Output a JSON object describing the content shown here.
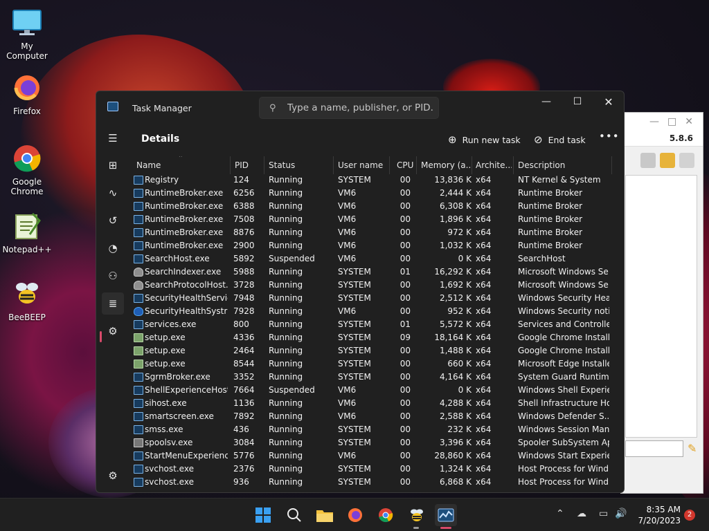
{
  "desktop": {
    "icons": [
      {
        "label": "My Computer"
      },
      {
        "label": "Firefox"
      },
      {
        "label": "Google Chrome"
      },
      {
        "label": "Notepad++"
      },
      {
        "label": "BeeBEEP"
      }
    ]
  },
  "background_window": {
    "version": "5.8.6"
  },
  "task_manager": {
    "title": "Task Manager",
    "search_placeholder": "Type a name, publisher, or PID...",
    "page_title": "Details",
    "run_new_task": "Run new task",
    "end_task": "End task",
    "more": "•••",
    "columns": [
      "Name",
      "PID",
      "Status",
      "User name",
      "CPU",
      "Memory (a...",
      "Archite...",
      "Description"
    ],
    "rows": [
      {
        "icon": "app",
        "name": "Registry",
        "pid": "124",
        "status": "Running",
        "user": "SYSTEM",
        "cpu": "00",
        "mem": "13,836 K",
        "arch": "x64",
        "desc": "NT Kernel & System"
      },
      {
        "icon": "app",
        "name": "RuntimeBroker.exe",
        "pid": "6256",
        "status": "Running",
        "user": "VM6",
        "cpu": "00",
        "mem": "2,444 K",
        "arch": "x64",
        "desc": "Runtime Broker"
      },
      {
        "icon": "app",
        "name": "RuntimeBroker.exe",
        "pid": "6388",
        "status": "Running",
        "user": "VM6",
        "cpu": "00",
        "mem": "6,308 K",
        "arch": "x64",
        "desc": "Runtime Broker"
      },
      {
        "icon": "app",
        "name": "RuntimeBroker.exe",
        "pid": "7508",
        "status": "Running",
        "user": "VM6",
        "cpu": "00",
        "mem": "1,896 K",
        "arch": "x64",
        "desc": "Runtime Broker"
      },
      {
        "icon": "app",
        "name": "RuntimeBroker.exe",
        "pid": "8876",
        "status": "Running",
        "user": "VM6",
        "cpu": "00",
        "mem": "972 K",
        "arch": "x64",
        "desc": "Runtime Broker"
      },
      {
        "icon": "app",
        "name": "RuntimeBroker.exe",
        "pid": "2900",
        "status": "Running",
        "user": "VM6",
        "cpu": "00",
        "mem": "1,032 K",
        "arch": "x64",
        "desc": "Runtime Broker"
      },
      {
        "icon": "app",
        "name": "SearchHost.exe",
        "pid": "5892",
        "status": "Suspended",
        "user": "VM6",
        "cpu": "00",
        "mem": "0 K",
        "arch": "x64",
        "desc": "SearchHost"
      },
      {
        "icon": "user",
        "name": "SearchIndexer.exe",
        "pid": "5988",
        "status": "Running",
        "user": "SYSTEM",
        "cpu": "01",
        "mem": "16,292 K",
        "arch": "x64",
        "desc": "Microsoft Windows Se..."
      },
      {
        "icon": "user",
        "name": "SearchProtocolHost....",
        "pid": "3728",
        "status": "Running",
        "user": "SYSTEM",
        "cpu": "00",
        "mem": "1,692 K",
        "arch": "x64",
        "desc": "Microsoft Windows Se..."
      },
      {
        "icon": "app",
        "name": "SecurityHealthServic...",
        "pid": "7948",
        "status": "Running",
        "user": "SYSTEM",
        "cpu": "00",
        "mem": "2,512 K",
        "arch": "x64",
        "desc": "Windows Security Hea..."
      },
      {
        "icon": "shield",
        "name": "SecurityHealthSystra...",
        "pid": "7928",
        "status": "Running",
        "user": "VM6",
        "cpu": "00",
        "mem": "952 K",
        "arch": "x64",
        "desc": "Windows Security noti..."
      },
      {
        "icon": "app",
        "name": "services.exe",
        "pid": "800",
        "status": "Running",
        "user": "SYSTEM",
        "cpu": "01",
        "mem": "5,572 K",
        "arch": "x64",
        "desc": "Services and Controlle..."
      },
      {
        "icon": "setup",
        "name": "setup.exe",
        "pid": "4336",
        "status": "Running",
        "user": "SYSTEM",
        "cpu": "09",
        "mem": "18,164 K",
        "arch": "x64",
        "desc": "Google Chrome Installer"
      },
      {
        "icon": "setup",
        "name": "setup.exe",
        "pid": "2464",
        "status": "Running",
        "user": "SYSTEM",
        "cpu": "00",
        "mem": "1,488 K",
        "arch": "x64",
        "desc": "Google Chrome Installer"
      },
      {
        "icon": "setup",
        "name": "setup.exe",
        "pid": "8544",
        "status": "Running",
        "user": "SYSTEM",
        "cpu": "00",
        "mem": "660 K",
        "arch": "x64",
        "desc": "Microsoft Edge Installer"
      },
      {
        "icon": "app",
        "name": "SgrmBroker.exe",
        "pid": "3352",
        "status": "Running",
        "user": "SYSTEM",
        "cpu": "00",
        "mem": "4,164 K",
        "arch": "x64",
        "desc": "System Guard Runtim..."
      },
      {
        "icon": "app",
        "name": "ShellExperienceHost....",
        "pid": "7664",
        "status": "Suspended",
        "user": "VM6",
        "cpu": "00",
        "mem": "0 K",
        "arch": "x64",
        "desc": "Windows Shell Experie..."
      },
      {
        "icon": "app",
        "name": "sihost.exe",
        "pid": "1136",
        "status": "Running",
        "user": "VM6",
        "cpu": "00",
        "mem": "4,288 K",
        "arch": "x64",
        "desc": "Shell Infrastructure Host"
      },
      {
        "icon": "app",
        "name": "smartscreen.exe",
        "pid": "7892",
        "status": "Running",
        "user": "VM6",
        "cpu": "00",
        "mem": "2,588 K",
        "arch": "x64",
        "desc": "Windows Defender S..."
      },
      {
        "icon": "app",
        "name": "smss.exe",
        "pid": "436",
        "status": "Running",
        "user": "SYSTEM",
        "cpu": "00",
        "mem": "232 K",
        "arch": "x64",
        "desc": "Windows Session Man..."
      },
      {
        "icon": "spool",
        "name": "spoolsv.exe",
        "pid": "3084",
        "status": "Running",
        "user": "SYSTEM",
        "cpu": "00",
        "mem": "3,396 K",
        "arch": "x64",
        "desc": "Spooler SubSystem App"
      },
      {
        "icon": "app",
        "name": "StartMenuExperienc...",
        "pid": "5776",
        "status": "Running",
        "user": "VM6",
        "cpu": "00",
        "mem": "28,860 K",
        "arch": "x64",
        "desc": "Windows Start Experie..."
      },
      {
        "icon": "app",
        "name": "svchost.exe",
        "pid": "2376",
        "status": "Running",
        "user": "SYSTEM",
        "cpu": "00",
        "mem": "1,324 K",
        "arch": "x64",
        "desc": "Host Process for Wind..."
      },
      {
        "icon": "app",
        "name": "svchost.exe",
        "pid": "936",
        "status": "Running",
        "user": "SYSTEM",
        "cpu": "00",
        "mem": "6,868 K",
        "arch": "x64",
        "desc": "Host Process for Wind..."
      }
    ]
  },
  "taskbar": {
    "time": "8:35 AM",
    "date": "7/20/2023",
    "notifications": "2"
  },
  "colors": {
    "accent": "#d84a6a",
    "window_bg": "#202020"
  }
}
